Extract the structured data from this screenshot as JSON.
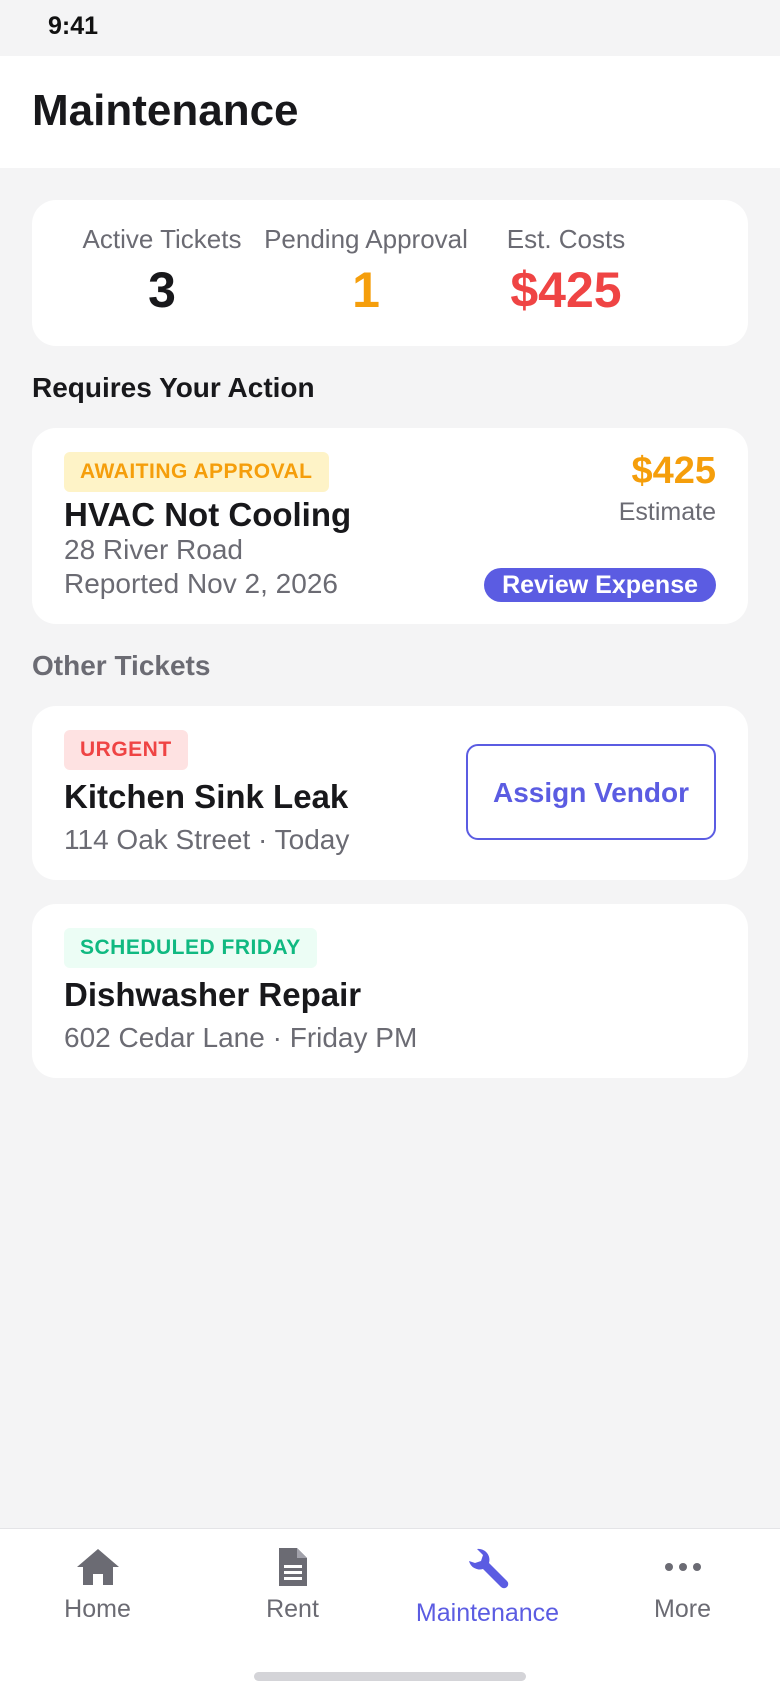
{
  "status_bar": {
    "time": "9:41"
  },
  "header": {
    "title": "Maintenance"
  },
  "summary": {
    "active_label": "Active Tickets",
    "active_value": "3",
    "pending_label": "Pending Approval",
    "pending_value": "1",
    "costs_label": "Est. Costs",
    "costs_value": "$425",
    "colors": {
      "active": "#18181b",
      "pending": "#f59e0b",
      "costs": "#ef4444"
    }
  },
  "requires_action": {
    "section_title": "Requires Your Action",
    "ticket": {
      "badge": "AWAITING APPROVAL",
      "title": "HVAC Not Cooling",
      "address": "28 River Road",
      "reported": "Reported Nov 2, 2026",
      "amount": "$425",
      "amount_label": "Estimate",
      "action_label": "Review Expense"
    }
  },
  "other_tickets": {
    "section_title": "Other Tickets",
    "tickets": [
      {
        "badge": "URGENT",
        "title": "Kitchen Sink Leak",
        "subtitle": "114 Oak Street · Today",
        "action_label": "Assign Vendor"
      },
      {
        "badge": "SCHEDULED FRIDAY",
        "title": "Dishwasher Repair",
        "subtitle": "602 Cedar Lane · Friday PM"
      }
    ]
  },
  "tab_bar": {
    "tabs": [
      {
        "label": "Home",
        "icon": "home-icon"
      },
      {
        "label": "Rent",
        "icon": "document-icon"
      },
      {
        "label": "Maintenance",
        "icon": "wrench-icon",
        "active": true
      },
      {
        "label": "More",
        "icon": "more-icon"
      }
    ]
  },
  "colors": {
    "accent": "#5b5ce2",
    "warning": "#f59e0b",
    "danger": "#ef4444",
    "success": "#10b981"
  }
}
